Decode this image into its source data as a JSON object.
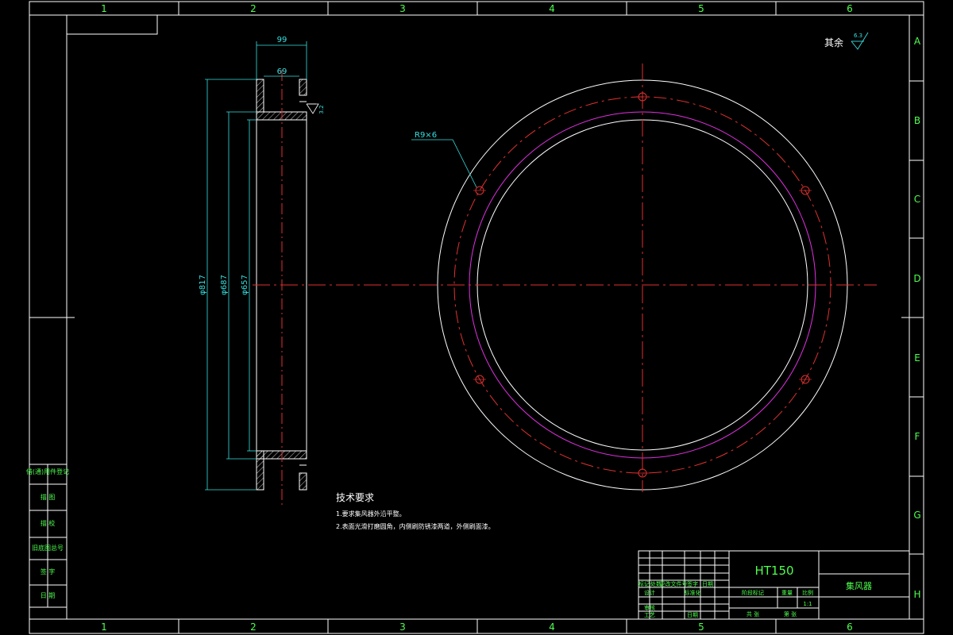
{
  "zones": {
    "columns": [
      "1",
      "2",
      "3",
      "4",
      "5",
      "6"
    ],
    "rows": [
      "A",
      "B",
      "C",
      "D",
      "E",
      "F",
      "G",
      "H"
    ]
  },
  "roughness": {
    "qiyu_label": "其余",
    "qiyu_value": "6.3",
    "face_value": "3.2"
  },
  "dimensions": {
    "overall_width": "99",
    "inner_width": "69",
    "outer_dia": "φ817",
    "mid_dia": "φ687",
    "inner_dia": "φ657",
    "holes": "R9×6"
  },
  "tech_requirements": {
    "title": "技术要求",
    "line1": "1.要求集风器外沿平整。",
    "line2": "2.表面光滑打磨圆角，内侧刷防锈漆两道，外侧刷面漆。"
  },
  "side_panel": {
    "rows": [
      "借(通)用件登记",
      "描 图",
      "描 校",
      "旧底图总号",
      "签 字",
      "日 期"
    ]
  },
  "title_block": {
    "material": "HT150",
    "part_name": "集风器",
    "hdr_mark": "标记",
    "hdr_count": "处数",
    "hdr_doc": "更改文件号",
    "hdr_sign": "签字",
    "hdr_date": "日期",
    "design": "设计",
    "standardization": "标准化",
    "review": "审核",
    "process": "工艺",
    "date": "日期",
    "stage_mark": "阶段标记",
    "weight": "重量",
    "scale": "比例",
    "scale_value": "1:1",
    "total_sheets": "共 张",
    "sheet_no": "第 张"
  }
}
